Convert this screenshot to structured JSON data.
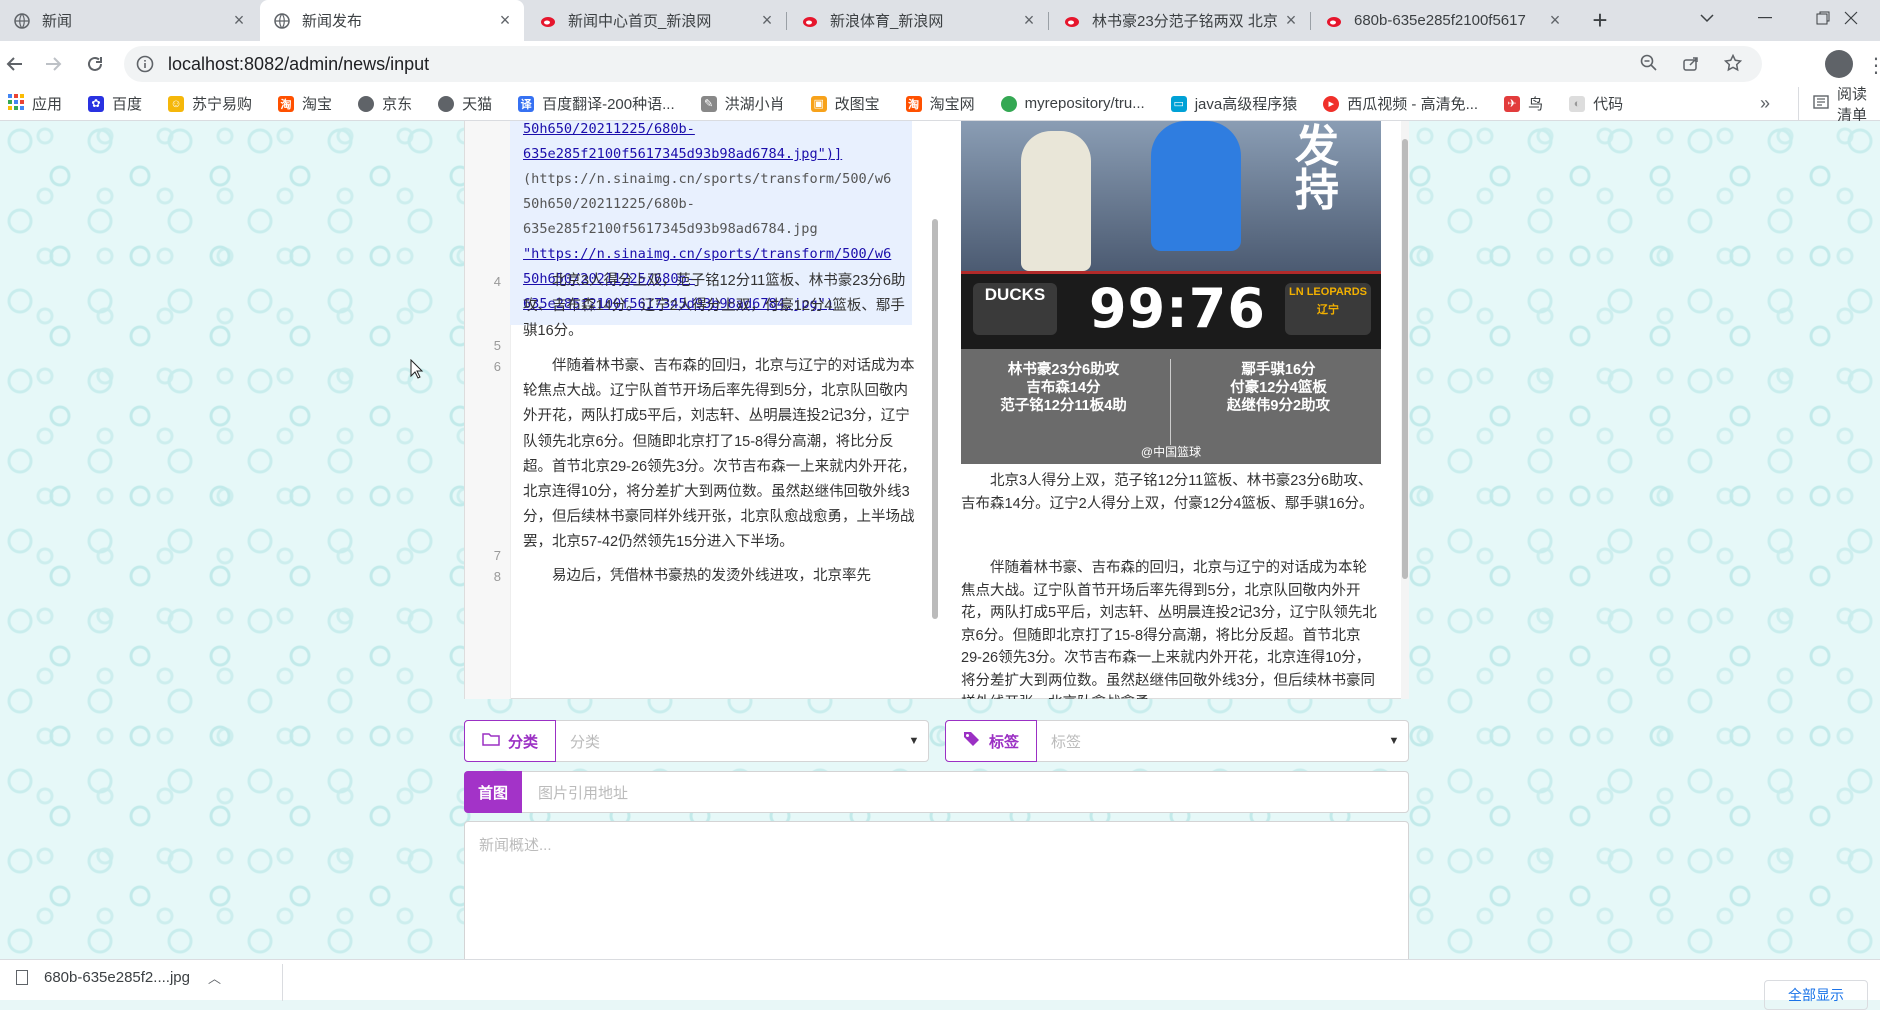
{
  "browser": {
    "tabs": [
      {
        "title": "新闻",
        "icon": "globe-icon"
      },
      {
        "title": "新闻发布",
        "icon": "globe-icon"
      },
      {
        "title": "新闻中心首页_新浪网",
        "icon": "sina-icon"
      },
      {
        "title": "新浪体育_新浪网",
        "icon": "sina-icon"
      },
      {
        "title": "林书豪23分范子铭两双 北京",
        "icon": "sina-icon"
      },
      {
        "title": "680b-635e285f2100f5617",
        "icon": "sina-icon"
      }
    ],
    "url": "localhost:8082/admin/news/input",
    "bookmarks": [
      {
        "label": "应用",
        "color": "#4285f4"
      },
      {
        "label": "百度",
        "color": "#2932e1"
      },
      {
        "label": "苏宁易购",
        "color": "#f5b70a"
      },
      {
        "label": "淘宝",
        "color": "#ff5000"
      },
      {
        "label": "京东",
        "color": "#5f6368"
      },
      {
        "label": "天猫",
        "color": "#5f6368"
      },
      {
        "label": "百度翻译-200种语...",
        "color": "#3671f2"
      },
      {
        "label": "洪湖小肖",
        "color": "#888888"
      },
      {
        "label": "改图宝",
        "color": "#f7a21b"
      },
      {
        "label": "淘宝网",
        "color": "#ff5000"
      },
      {
        "label": "myrepository/tru...",
        "color": "#34a853"
      },
      {
        "label": "java高级程序猿",
        "color": "#00a1d6"
      },
      {
        "label": "西瓜视频 - 高清免...",
        "color": "#f0302a"
      },
      {
        "label": "鸟",
        "color": "#e23c3c"
      },
      {
        "label": "代码",
        "color": "#dddddd"
      }
    ],
    "reading_list": "阅读清单"
  },
  "editor": {
    "gutter_numbers": [
      "4",
      "5",
      "6",
      "7",
      "8"
    ],
    "link_lines": [
      "50h650/20211225/680b-",
      "635e285f2100f5617345d93b98ad6784.jpg\")]",
      "(https://n.sinaimg.cn/sports/transform/500/w6",
      "50h650/20211225/680b-",
      "635e285f2100f5617345d93b98ad6784.jpg",
      "\"https://n.sinaimg.cn/sports/transform/500/w6",
      "50h650/20211225/680b-",
      "635e285f2100f5617345d93b98ad6784.jpg\")"
    ],
    "para4": "北京3人得分上双，范子铭12分11篮板、林书豪23分6助攻、吉布森14分。辽宁2人得分上双，付豪12分4篮板、鄢手骐16分。",
    "para6": "伴随着林书豪、吉布森的回归，北京与辽宁的对话成为本轮焦点大战。辽宁队首节开场后率先得到5分，北京队回敬内外开花，两队打成5平后，刘志轩、丛明晨连投2记3分，辽宁队领先北京6分。但随即北京打了15-8得分高潮，将比分反超。首节北京29-26领先3分。次节吉布森一上来就内外开花，北京连得10分，将分差扩大到两位数。虽然赵继伟回敬外线3分，但后续林书豪同样外线开张，北京队愈战愈勇，上半场战罢，北京57-42仍然领先15分进入下半场。",
    "para8": "易边后，凭借林书豪热的发烫外线进攻，北京率先"
  },
  "preview": {
    "image_text": {
      "corner": "发\n持",
      "score": "99:76",
      "team_left": "DUCKS",
      "team_right": "LN LEOPARDS 辽宁",
      "stats_left": "林书豪23分6助攻\n吉布森14分\n范子铭12分11板4助",
      "stats_right": "鄢手骐16分\n付豪12分4篮板\n赵继伟9分2助攻",
      "watermark": "@中国篮球"
    },
    "para4": "北京3人得分上双，范子铭12分11篮板、林书豪23分6助攻、吉布森14分。辽宁2人得分上双，付豪12分4篮板、鄢手骐16分。",
    "para6": "伴随着林书豪、吉布森的回归，北京与辽宁的对话成为本轮焦点大战。辽宁队首节开场后率先得到5分，北京队回敬内外开花，两队打成5平后，刘志轩、丛明晨连投2记3分，辽宁队领先北京6分。但随即北京打了15-8得分高潮，将比分反超。首节北京29-26领先3分。次节吉布森一上来就内外开花，北京连得10分，将分差扩大到两位数。虽然赵继伟回敬外线3分，但后续林书豪同样外线开张，北京队愈战愈勇"
  },
  "form": {
    "category": {
      "label": "分类",
      "placeholder": "分类"
    },
    "tags": {
      "label": "标签",
      "placeholder": "标签"
    },
    "first_image": {
      "label": "首图",
      "placeholder": "图片引用地址"
    },
    "summary_placeholder": "新闻概述..."
  },
  "downloads": {
    "file": "680b-635e285f2....jpg",
    "show_all": "全部显示"
  },
  "colors": {
    "accent": "#a333c8",
    "link": "#1a0dab"
  }
}
